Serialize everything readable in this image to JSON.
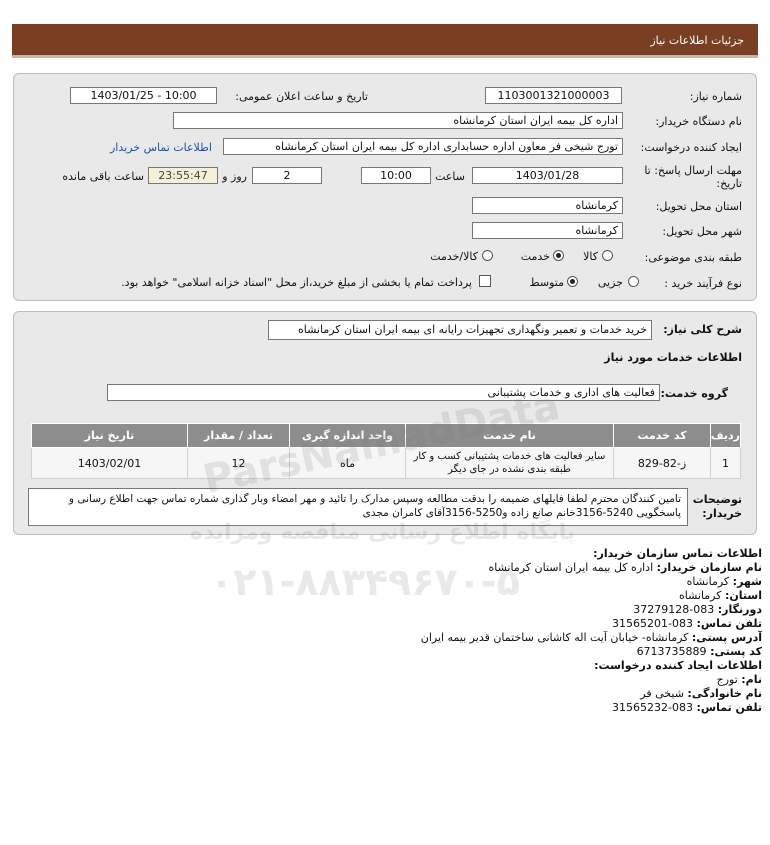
{
  "header": {
    "title": "جزئیات اطلاعات نیاز"
  },
  "form": {
    "need_number_label": "شماره نیاز:",
    "need_number": "1103001321000003",
    "announce_label": "تاریخ و ساعت اعلان عمومی:",
    "announce_value": "1403/01/25 - 10:00",
    "buyer_label": "نام دستگاه خریدار:",
    "buyer_value": "اداره کل بیمه ایران استان کرمانشاه",
    "creator_label": "ایجاد کننده درخواست:",
    "creator_value": "تورج شیخی فر معاون اداره حسابداری اداره کل بیمه ایران استان کرمانشاه",
    "buyer_contact_link": "اطلاعات تماس خریدار",
    "deadline_label": "مهلت ارسال پاسخ: تا تاریخ:",
    "deadline_date": "1403/01/28",
    "hour_label": "ساعت",
    "deadline_time": "10:00",
    "days_value": "2",
    "days_label": "روز و",
    "remaining_time": "23:55:47",
    "remaining_label": "ساعت باقی مانده",
    "province_label": "استان محل تحویل:",
    "province_value": "کرمانشاه",
    "city_label": "شهر محل تحویل:",
    "city_value": "کرمانشاه",
    "category_label": "طبقه بندی موضوعی:",
    "category_options": [
      "کالا",
      "خدمت",
      "کالا/خدمت"
    ],
    "category_selected": "خدمت",
    "process_label": "نوع فرآیند خرید :",
    "process_options": [
      "جزیی",
      "متوسط"
    ],
    "process_selected": "متوسط",
    "payment_note": "پرداخت تمام یا بخشی از مبلغ خرید،از محل \"اسناد خزانه اسلامی\" خواهد بود."
  },
  "details": {
    "summary_label": "شرح کلی نیاز:",
    "summary_value": "خرید خدمات و تعمیر ونگهداری تجهیزات رایانه ای بیمه ایران استان کرمانشاه",
    "services_heading": "اطلاعات خدمات مورد نیاز",
    "group_label": "گروه خدمت:",
    "group_value": "فعالیت های اداری و خدمات پشتیبانی",
    "table": {
      "headers": [
        "ردیف",
        "کد خدمت",
        "نام خدمت",
        "واحد اندازه گیری",
        "تعداد / مقدار",
        "تاریخ نیاز"
      ],
      "rows": [
        [
          "1",
          "ز-82-829",
          "سایر فعالیت های خدمات پشتیبانی کسب و کار طبقه بندی نشده در جای دیگر",
          "ماه",
          "12",
          "1403/02/01"
        ]
      ]
    },
    "buyer_notes_label": "توضیحات خریدار:",
    "buyer_notes": "تامین کنندگان محترم لطفا فایلهای ضمیمه را بدقت مطالعه وسپس مدارک را تائید و مهر امضاء وبار گذاری شماره تماس جهت اطلاع رسانی و پاسخگویی 5240-3156خانم صانع زاده و5250-3156آقای کامران مجدی"
  },
  "contact": {
    "org_heading": "اطلاعات تماس سازمان خریدار:",
    "buyer_name_label": "نام سازمان خریدار:",
    "buyer_name": "اداره کل بیمه ایران استان کرمانشاه",
    "city_label": "شهر:",
    "city": "کرمانشاه",
    "province_label": "استان:",
    "province": "کرمانشاه",
    "fax_label": "دورنگار:",
    "fax": "083-37279128",
    "phone_label": "تلفن تماس:",
    "phone": "083-31565201",
    "address_label": "آدرس پستی:",
    "address": "کرمانشاه- خیابان آیت اله کاشانی ساختمان قدیر بیمه ایران",
    "postal_label": "کد پستی:",
    "postal": "6713735889",
    "creator_heading": "اطلاعات ایجاد کننده درخواست:",
    "first_name_label": "نام:",
    "first_name": "تورج",
    "last_name_label": "نام خانوادگی:",
    "last_name": "شیخی فر",
    "creator_phone_label": "تلفن تماس:",
    "creator_phone": "083-31565232"
  },
  "watermark": {
    "line1": "ParsNamadData",
    "line2": "پایگاه اطلاع رسانی مناقصه ومزایده",
    "line3": "۰۲۱-۸۸۳۴۹۶۷۰-۵"
  },
  "colors": {
    "header": "#7a3e22",
    "link": "#1f4fa8",
    "panel": "#e9e9e9",
    "table_header": "#8d8d8d"
  }
}
